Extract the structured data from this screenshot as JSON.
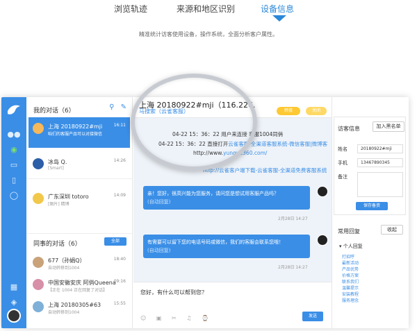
{
  "tabs": {
    "items": [
      "浏览轨迹",
      "来源和地区识别",
      "设备信息"
    ],
    "active_index": 2
  },
  "subtitle": "精准统计访客使用设备，操作系统，全面分析客户属性。",
  "conv_list": {
    "my_title": "我的对话（6）",
    "my_items": [
      {
        "name": "上海 20180922#mji",
        "sub": "咱们的客服产品可以对接微信",
        "time": "16:11"
      },
      {
        "name": "冰岛 Q.",
        "sub": "[Smart]",
        "time": "14:26"
      },
      {
        "name": "广东深圳 totoro",
        "sub": "[图片] 精博",
        "time": "14:09"
      }
    ],
    "colleague_title": "同事的对话（6）",
    "all_button": "全部",
    "colleague_items": [
      {
        "name": "677（孙娟Q）",
        "sub": "自动转移到1004",
        "time": "18:40"
      },
      {
        "name": "中国安徽安庆 阿俏Queena",
        "sub": "【正在 1004 正在回复了对话】",
        "time": "09:16"
      },
      {
        "name": "上海 20180305#63",
        "sub": "自动转移到1004",
        "time": "15:55"
      }
    ]
  },
  "chat": {
    "title": "上海 20180922#mji（116.226.",
    "source": "马搜索（云雀客服）",
    "transfer_btn": "转接",
    "end_btn": "关闭",
    "sys_lines": [
      {
        "pre": "04-22 15：36：22 用户",
        "link": "",
        "post": "来连接 客服1004同俏"
      },
      {
        "pre": "04-22 15：36：22 直接打开",
        "link": "云雀客服-全渠道客服系统-微信客服|微博客",
        "post": ""
      },
      {
        "pre": "http://www.",
        "link": "yunque360.com/",
        "post": ""
      },
      {
        "pre": "",
        "link": "http://云雀客户端下载-云雀客服-全渠道免费客服系统",
        "post": ""
      }
    ],
    "messages": [
      {
        "text": "亲！您好，很高兴能为您服务，请问您是想试用客服产品吗？",
        "auto": "(自动回复)",
        "time": "2月28日 14:27"
      },
      {
        "text": "有需要可以留下您的电话号码或微信，我们的客服会联系您哦！",
        "auto": "(自动回复)",
        "time": "2月28日 14:27"
      }
    ],
    "input_text": "您好，有什么可以帮到您？",
    "tools": "☺ ▣ ✂ ♫ ⌚",
    "send_btn": "发送"
  },
  "visitor": {
    "title": "访客信息",
    "blacklist_btn": "加入黑名单",
    "name_label": "姓名",
    "name_value": "20180922#mji",
    "phone_label": "手机",
    "phone_value": "13467890345",
    "note_label": "备注",
    "save_btn": "保存备资"
  },
  "quick": {
    "title": "常用回复",
    "collapse_btn": "收起",
    "personal": "个人回复",
    "items": [
      "打招呼",
      "最新活动",
      "产品优势",
      "价格方案",
      "联系我们",
      "温馨提示",
      "安装教程",
      "服务理念"
    ]
  },
  "colors": {
    "accent": "#3a8ee6",
    "yellow": "#ffc933"
  }
}
